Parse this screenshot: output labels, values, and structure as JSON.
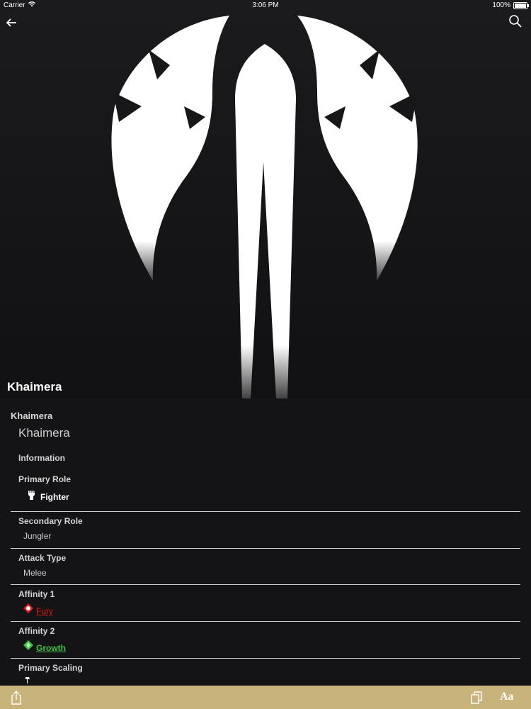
{
  "status_bar": {
    "carrier": "Carrier",
    "time": "3:06 PM",
    "battery": "100%"
  },
  "header": {
    "title": "Khaimera",
    "back_icon": "arrow-left-icon",
    "search_icon": "search-icon"
  },
  "entry": {
    "heading": "Khaimera",
    "name": "Khaimera",
    "section": "Information"
  },
  "fields": [
    {
      "label": "Primary Role",
      "value": "Fighter",
      "icon": "fist-icon"
    },
    {
      "label": "Secondary Role",
      "value": "Jungler"
    },
    {
      "label": "Attack Type",
      "value": "Melee"
    },
    {
      "label": "Affinity 1",
      "value": "Fury",
      "icon": "fury-icon",
      "color": "#e21a1a"
    },
    {
      "label": "Affinity 2",
      "value": "Growth",
      "icon": "growth-icon",
      "color": "#3ec43e"
    },
    {
      "label": "Primary Scaling",
      "value": "",
      "icon": "axe-icon"
    }
  ],
  "bottom_bar": {
    "share_icon": "share-icon",
    "copy_icon": "copy-icon",
    "font_label": "Aa"
  },
  "colors": {
    "background": "#141416",
    "bottom_bar": "#c8b47a",
    "fury": "#e21a1a",
    "growth": "#3ec43e"
  }
}
